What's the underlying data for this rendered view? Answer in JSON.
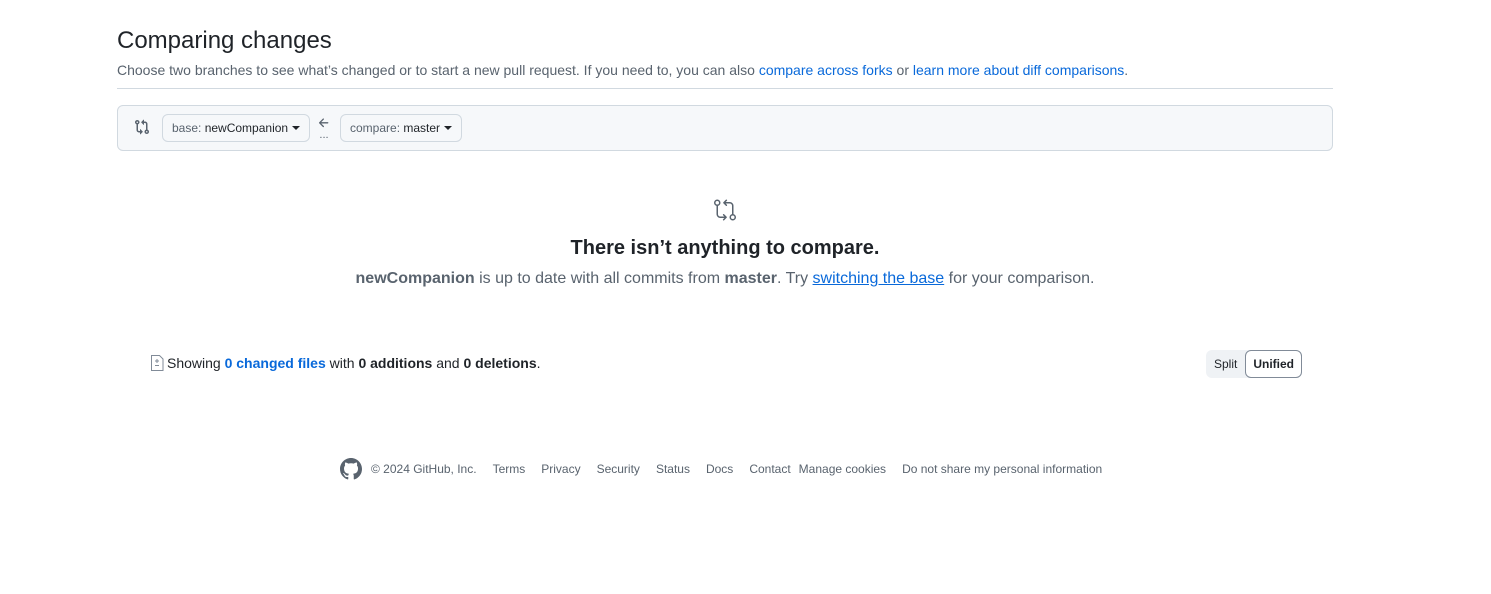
{
  "header": {
    "title": "Comparing changes",
    "subtitle_text": "Choose two branches to see what’s changed or to start a new pull request. If you need to, you can also",
    "compare_forks_link": "compare across forks",
    "or_text": "or",
    "learn_more_link": "learn more about diff comparisons",
    "period": "."
  },
  "range": {
    "base_prefix": "base:",
    "base_branch": "newCompanion",
    "compare_prefix": "compare:",
    "compare_branch": "master",
    "dots": "..."
  },
  "blankslate": {
    "title": "There isn’t anything to compare.",
    "branch": "newCompanion",
    "text1": "is up to date with all commits from",
    "base": "master",
    "text2": ". Try",
    "link": "switching the base",
    "text3": "for your comparison."
  },
  "toc": {
    "showing": "Showing",
    "changed_files": "0 changed files",
    "with": "with",
    "additions": "0 additions",
    "and": "and",
    "deletions": "0 deletions",
    "period": "."
  },
  "diff_view": {
    "split_label": "Split",
    "unified_label": "Unified",
    "selected": "Unified"
  },
  "footer": {
    "copyright": "© 2024 GitHub, Inc.",
    "links": [
      "Terms",
      "Privacy",
      "Security",
      "Status",
      "Docs",
      "Contact",
      "Manage cookies",
      "Do not share my personal information"
    ]
  },
  "colors": {
    "accent": "#0969da",
    "text": "#1f2328",
    "muted": "#59636e",
    "border": "#d1d9e0",
    "canvas_subtle": "#f6f8fa"
  }
}
